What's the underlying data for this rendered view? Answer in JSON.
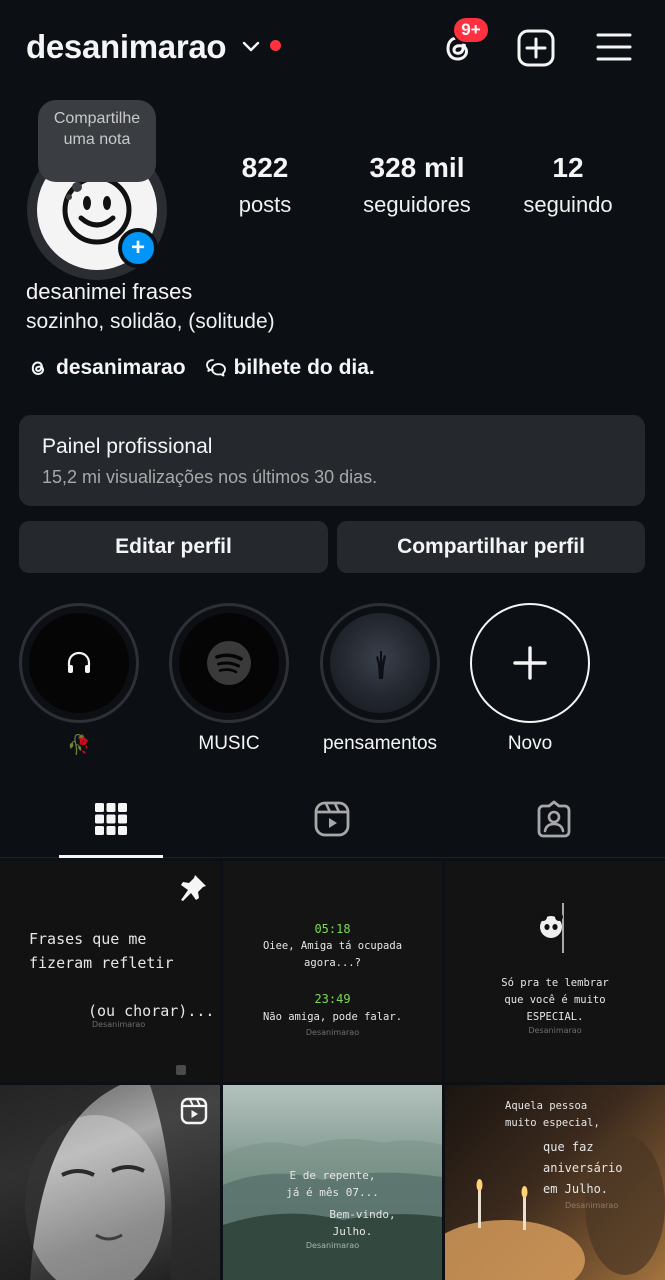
{
  "header": {
    "username": "desanimarao",
    "threads_badge": "9+",
    "icons": [
      "chevron-down-icon",
      "threads-icon",
      "add-square-icon",
      "menu-icon"
    ]
  },
  "profile": {
    "note_prompt": "Compartilhe uma nota",
    "stats": {
      "posts_count": "822",
      "posts_label": "posts",
      "followers_count": "328 mil",
      "followers_label": "seguidores",
      "following_count": "12",
      "following_label": "seguindo"
    },
    "display_name": "desanimei frases",
    "bio": "sozinho, solidão, (solitude)",
    "threads_handle": "desanimarao",
    "link_text": "bilhete do dia."
  },
  "professional_panel": {
    "title": "Painel profissional",
    "subtitle": "15,2 mi visualizações nos últimos 30 dias."
  },
  "actions": {
    "edit_label": "Editar perfil",
    "share_label": "Compartilhar perfil"
  },
  "highlights": [
    {
      "label": "🥀",
      "icon": "headphones-icon"
    },
    {
      "label": "MUSIC",
      "icon": "spotify-icon"
    },
    {
      "label": "pensamentos",
      "icon": "dark-photo"
    },
    {
      "label": "Novo",
      "icon": "plus-icon"
    }
  ],
  "tabs": [
    "grid-icon",
    "reels-icon",
    "tagged-icon"
  ],
  "posts": {
    "p1": {
      "line1": "Frases que me",
      "line2": "fizeram refletir",
      "line3": "(ou chorar)...",
      "watermark": "Desanimarao"
    },
    "p2": {
      "time1": "05:18",
      "msg1a": "Oiee, Amiga tá ocupada",
      "msg1b": "agora...?",
      "time2": "23:49",
      "msg2": "Não amiga, pode falar.",
      "watermark": "Desanimarao"
    },
    "p3": {
      "line1": "Só pra te lembrar",
      "line2": "que você é muito",
      "line3": "ESPECIAL.",
      "watermark": "Desanimarao"
    },
    "p5": {
      "line1": "E de repente,",
      "line2": "já é mês 07...",
      "line3": "Bem-vindo,",
      "line4": "Julho.",
      "watermark": "Desanimarao"
    },
    "p6": {
      "line1": "Aquela pessoa",
      "line2": "muito especial,",
      "line3": "que faz",
      "line4": "aniversário",
      "line5": "em Julho.",
      "watermark": "Desanimarao"
    }
  },
  "colors": {
    "background": "#0c1014",
    "accent_blue": "#0095f6",
    "notification_red": "#ff3040",
    "surface": "#25292e"
  }
}
